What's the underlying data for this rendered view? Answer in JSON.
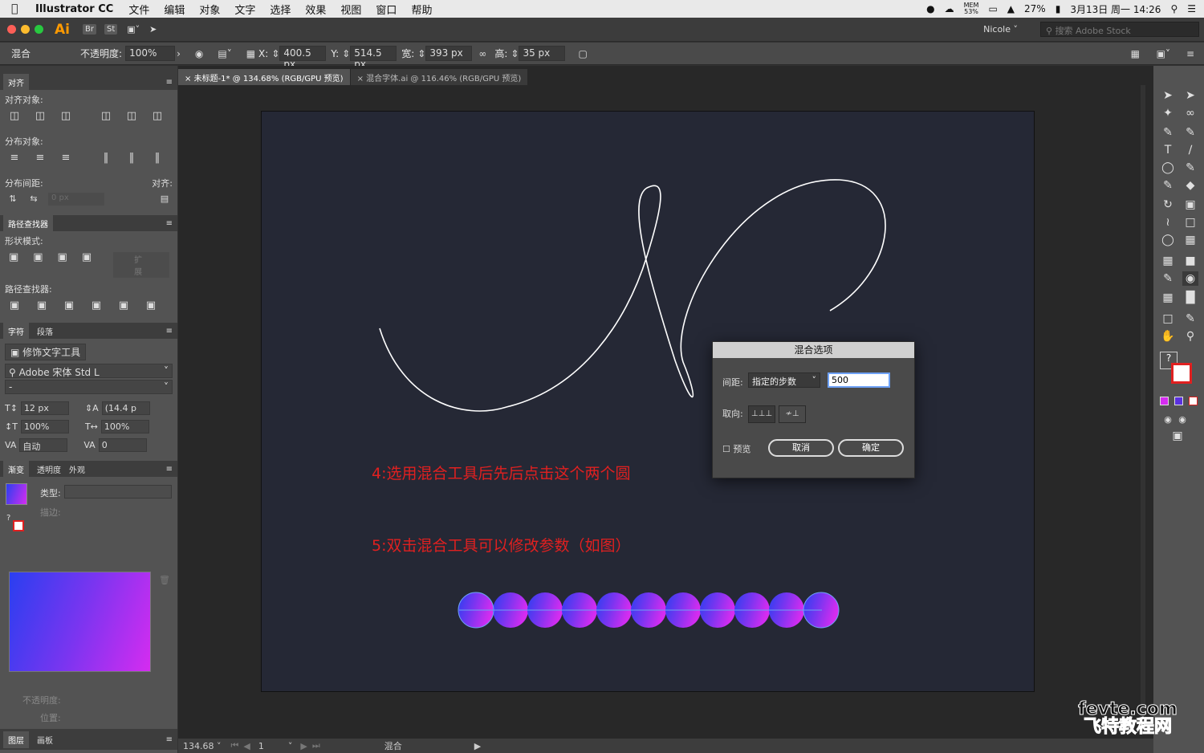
{
  "menubar": {
    "app_name": "Illustrator CC",
    "items": [
      "文件",
      "编辑",
      "对象",
      "文字",
      "选择",
      "效果",
      "视图",
      "窗口",
      "帮助"
    ],
    "status": {
      "mem_label": "MEM",
      "mem_value": "53%",
      "battery": "27%",
      "date": "3月13日 周一 14:26"
    }
  },
  "appbar": {
    "logo": "Ai",
    "br": "Br",
    "st": "St",
    "user": "Nicole",
    "search_placeholder": "搜索 Adobe Stock"
  },
  "control": {
    "mode": "混合",
    "opacity_label": "不透明度:",
    "opacity_value": "100%",
    "x_label": "X:",
    "x_value": "400.5 px",
    "y_label": "Y:",
    "y_value": "514.5 px",
    "w_label": "宽:",
    "w_value": "393 px",
    "h_label": "高:",
    "h_value": "35 px"
  },
  "align_panel": {
    "tab": "对齐",
    "align_objects": "对齐对象:",
    "distribute_objects": "分布对象:",
    "distribute_spacing": "分布间距:",
    "align_to": "对齐:",
    "spacing_value": "0 px"
  },
  "pathfinder": {
    "tab": "路径查找器",
    "shape_modes": "形状模式:",
    "expand": "扩展",
    "pathfinders": "路径查找器:"
  },
  "character": {
    "tabs": [
      "字符",
      "段落"
    ],
    "touch_tool": "修饰文字工具",
    "font": "Adobe 宋体 Std L",
    "style": "-",
    "size": "12 px",
    "leading": "(14.4 p",
    "vscale": "100%",
    "hscale": "100%",
    "tracking_kern": "自动",
    "tracking": "0"
  },
  "gradient": {
    "tabs": [
      "渐变",
      "透明度",
      "外观"
    ],
    "type_label": "类型:",
    "stroke_label": "描边:",
    "opacity_label": "不透明度:",
    "location_label": "位置:"
  },
  "layers": {
    "tabs": [
      "图层",
      "画板"
    ]
  },
  "doc_tabs": [
    "未标题-1* @ 134.68% (RGB/GPU 预览)",
    "混合字体.ai @ 116.46% (RGB/GPU 预览)"
  ],
  "annotations": {
    "step4": "4:选用混合工具后先后点击这个两个圆",
    "step5": "5:双击混合工具可以修改参数（如图）"
  },
  "dialog": {
    "title": "混合选项",
    "spacing_label": "间距:",
    "spacing_mode": "指定的步数",
    "steps_value": "500",
    "orientation_label": "取向:",
    "preview_label": "预览",
    "cancel": "取消",
    "ok": "确定"
  },
  "statusbar": {
    "zoom": "134.68",
    "artboard": "1",
    "tool": "混合"
  },
  "watermark": {
    "line1": "fevte.com",
    "line2": "飞特教程网"
  },
  "colors": {
    "accent": "#6ea1f5",
    "annotation": "#e02020",
    "grad_start": "#2a3ff0",
    "grad_end": "#d52cf0",
    "artboard": "#252835"
  }
}
